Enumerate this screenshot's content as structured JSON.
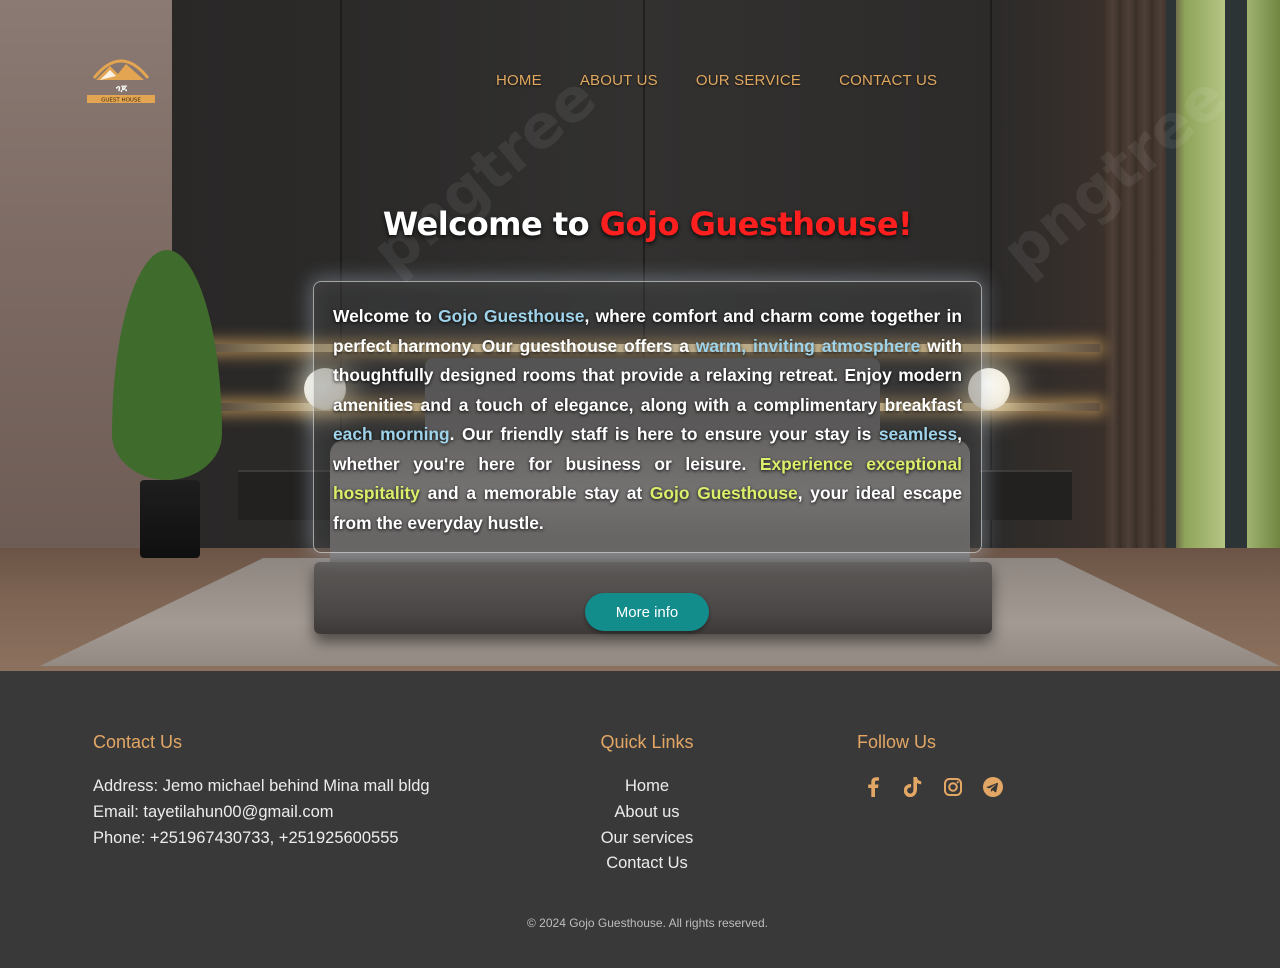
{
  "brand": {
    "logo_text": "GUEST HOUSE"
  },
  "nav": {
    "items": [
      "HOME",
      "ABOUT US",
      "OUR SERVICE",
      "CONTACT US"
    ]
  },
  "hero": {
    "title_prefix": "Welcome to ",
    "title_accent": "Gojo Guesthouse!",
    "paragraph": {
      "s1": "Welcome to ",
      "s2": "Gojo Guesthouse",
      "s3": ", where comfort and charm come together in perfect harmony. Our guesthouse offers a ",
      "s4": "warm, inviting atmosphere",
      "s5": " with thoughtfully designed rooms that provide a relaxing retreat. Enjoy modern amenities and a touch of elegance, along with a complimentary breakfast ",
      "s6": "each morning",
      "s7": ". Our friendly staff is here to ensure your stay is ",
      "s8": "seamless",
      "s9": ", whether you're here for business or leisure. ",
      "s10": "Experience exceptional hospitality",
      "s11": " and a memorable stay at ",
      "s12": "Gojo Guesthouse",
      "s13": ", your ideal escape from the everyday hustle."
    },
    "button_label": "More info"
  },
  "footer": {
    "contact": {
      "heading": "Contact Us",
      "address": "Address: Jemo michael behind Mina mall bldg",
      "email": "Email: tayetilahun00@gmail.com",
      "phone": "Phone: +251967430733, +251925600555"
    },
    "quick_links": {
      "heading": "Quick Links",
      "items": [
        "Home",
        "About us",
        "Our services",
        "Contact Us"
      ]
    },
    "follow": {
      "heading": "Follow Us",
      "icons": [
        "facebook-icon",
        "tiktok-icon",
        "instagram-icon",
        "telegram-icon"
      ]
    },
    "copyright": "© 2024 Gojo Guesthouse. All rights reserved."
  },
  "colors": {
    "accent_orange": "#e0a85f",
    "title_red": "#ff1f1f",
    "button_teal": "#138c8c",
    "footer_bg": "#3a393a",
    "highlight_blue": "#9fd3ea",
    "highlight_green": "#dcee6a"
  }
}
